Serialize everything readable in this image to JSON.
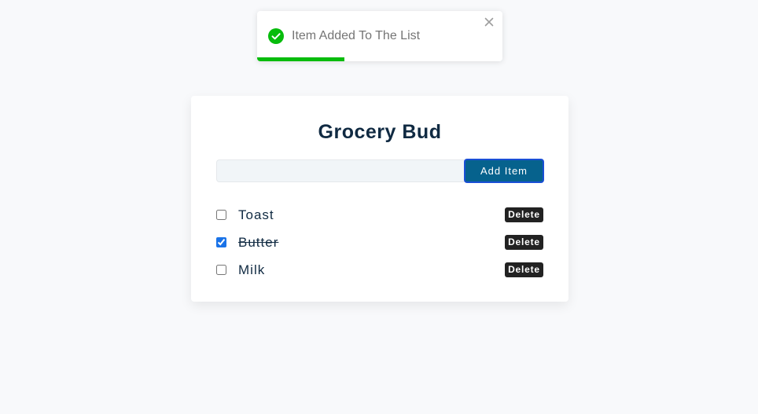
{
  "toast": {
    "message": "Item Added To The List",
    "icon": "check-circle-icon",
    "close_icon": "close-icon",
    "progress_fraction": 0.355,
    "accent_color": "#07bc0c"
  },
  "app": {
    "title": "Grocery Bud",
    "input": {
      "value": "",
      "placeholder": ""
    },
    "add_button_label": "Add Item",
    "button_color": "#06628d",
    "items": [
      {
        "name": "Toast",
        "checked": false,
        "delete_label": "Delete"
      },
      {
        "name": "Butter",
        "checked": true,
        "delete_label": "Delete"
      },
      {
        "name": "Milk",
        "checked": false,
        "delete_label": "Delete"
      }
    ]
  }
}
